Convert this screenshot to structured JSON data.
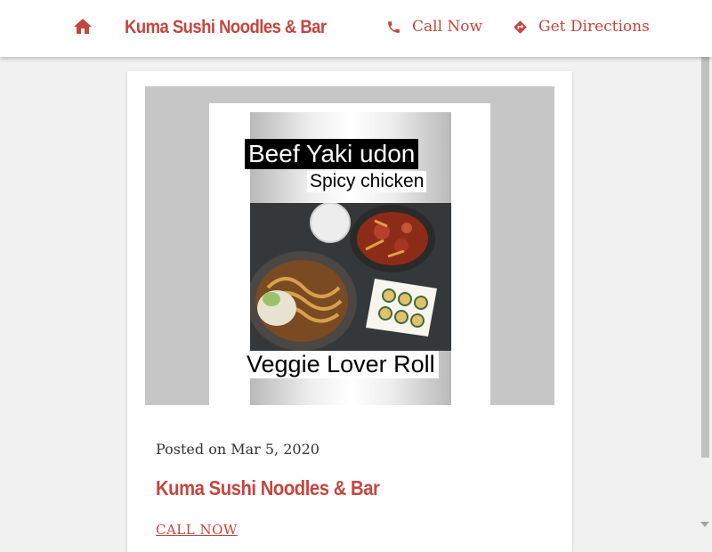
{
  "header": {
    "home_icon": "home-icon",
    "brand": "Kuma Sushi Noodles & Bar",
    "call_icon": "phone-icon",
    "call_label": "Call Now",
    "directions_icon": "directions-icon",
    "directions_label": "Get Directions"
  },
  "post": {
    "image_labels": {
      "top": "Beef Yaki udon",
      "middle": "Spicy chicken",
      "bottom": "Veggie Lover Roll"
    },
    "posted": "Posted on Mar 5, 2020",
    "title": "Kuma Sushi Noodles & Bar",
    "cta": "CALL NOW"
  },
  "colors": {
    "accent": "#c5453f",
    "page_bg": "#f1f1f1",
    "card_bg": "#ffffff"
  }
}
